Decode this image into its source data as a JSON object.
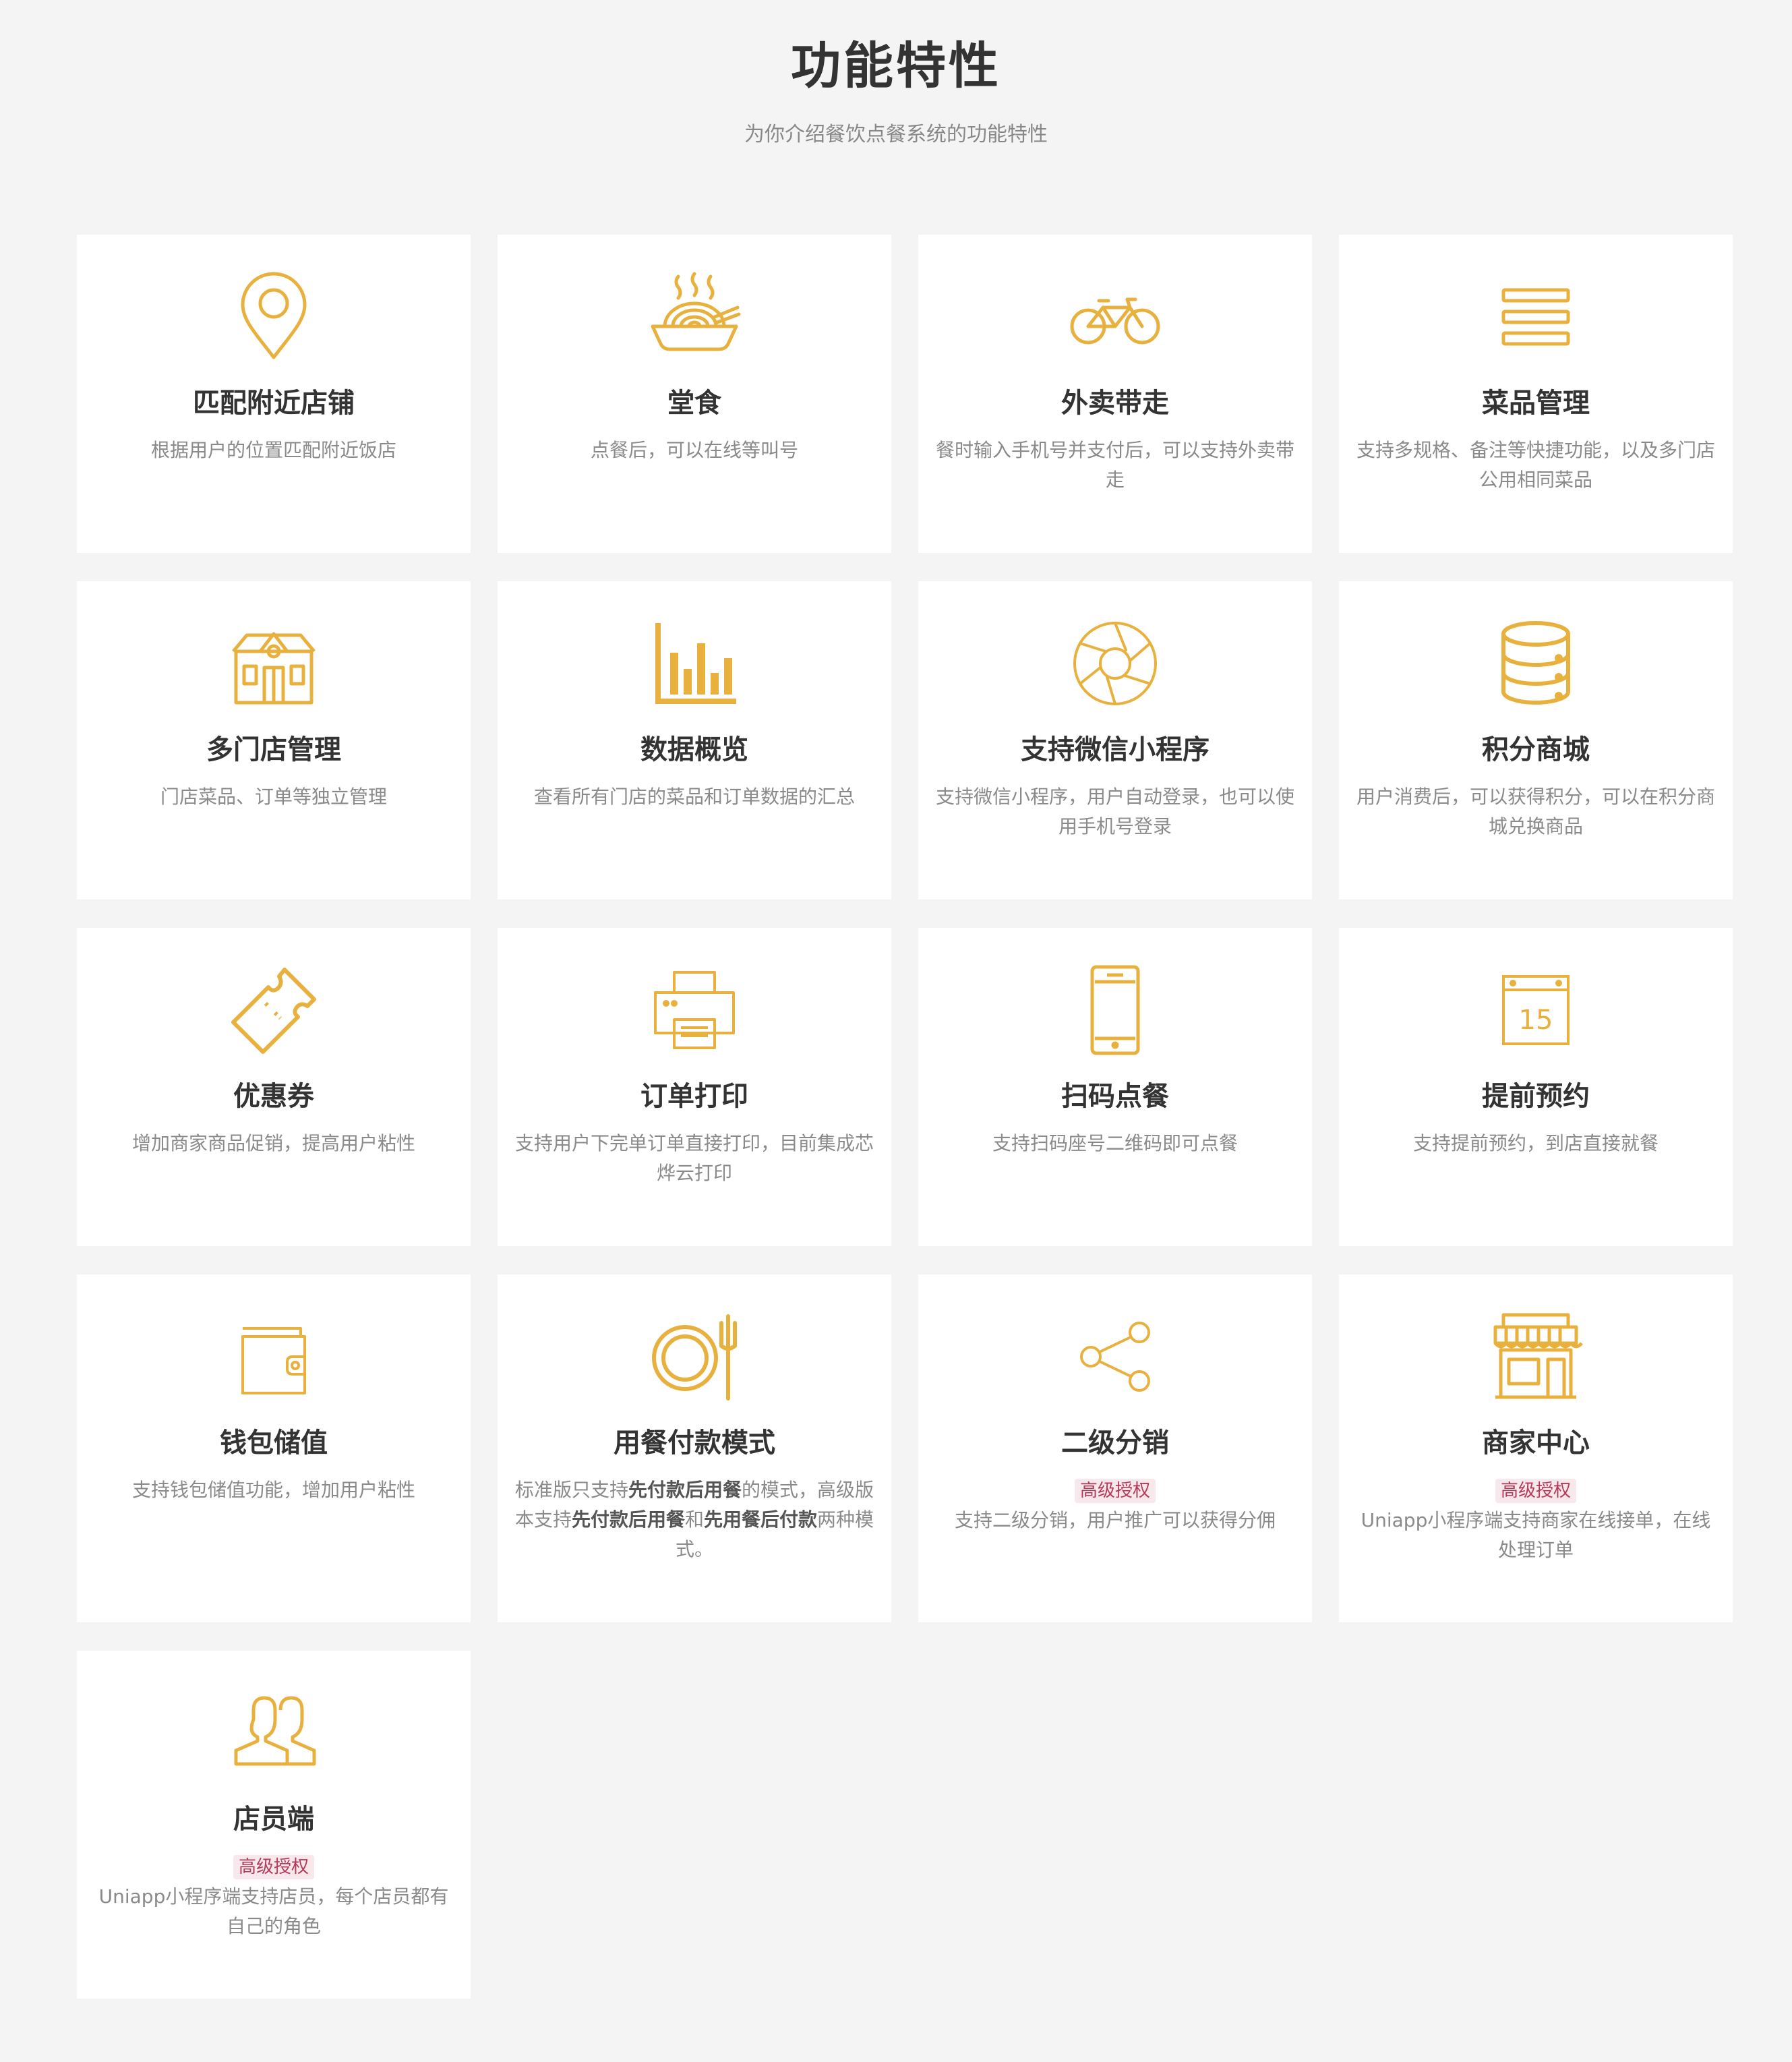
{
  "header": {
    "title": "功能特性",
    "subtitle": "为你介绍餐饮点餐系统的功能特性"
  },
  "colors": {
    "accent": "#e8b13e",
    "badge_bg": "#f8e8ec",
    "badge_text": "#b43a5a"
  },
  "features": [
    {
      "title": "匹配附近店铺",
      "desc": "根据用户的位置匹配附近饭店",
      "icon": "location-pin-icon"
    },
    {
      "title": "堂食",
      "desc": "点餐后，可以在线等叫号",
      "icon": "noodle-bowl-icon"
    },
    {
      "title": "外卖带走",
      "desc": "餐时输入手机号并支付后，可以支持外卖带走",
      "icon": "bicycle-icon"
    },
    {
      "title": "菜品管理",
      "desc": "支持多规格、备注等快捷功能，以及多门店公用相同菜品",
      "icon": "list-bars-icon"
    },
    {
      "title": "多门店管理",
      "desc": "门店菜品、订单等独立管理",
      "icon": "house-icon"
    },
    {
      "title": "数据概览",
      "desc": "查看所有门店的菜品和订单数据的汇总",
      "icon": "bar-chart-icon"
    },
    {
      "title": "支持微信小程序",
      "desc": "支持微信小程序，用户自动登录，也可以使用手机号登录",
      "icon": "aperture-icon"
    },
    {
      "title": "积分商城",
      "desc": "用户消费后，可以获得积分，可以在积分商城兑换商品",
      "icon": "database-icon"
    },
    {
      "title": "优惠券",
      "desc": "增加商家商品促销，提高用户粘性",
      "icon": "ticket-icon"
    },
    {
      "title": "订单打印",
      "desc": "支持用户下完单订单直接打印，目前集成芯烨云打印",
      "icon": "printer-icon"
    },
    {
      "title": "扫码点餐",
      "desc": "支持扫码座号二维码即可点餐",
      "icon": "phone-icon"
    },
    {
      "title": "提前预约",
      "desc": "支持提前预约，到店直接就餐",
      "icon": "calendar-icon",
      "calendar_day": "15"
    },
    {
      "title": "钱包储值",
      "desc": "支持钱包储值功能，增加用户粘性",
      "icon": "wallet-icon"
    },
    {
      "title": "用餐付款模式",
      "desc_parts": [
        "标准版只支持",
        "先付款后用餐",
        "的模式，高级版本支持",
        "先付款后用餐",
        "和",
        "先用餐后付款",
        "两种模式。"
      ],
      "icon": "plate-fork-icon"
    },
    {
      "title": "二级分销",
      "badge": "高级授权",
      "desc": "支持二级分销，用户推广可以获得分佣",
      "icon": "share-icon"
    },
    {
      "title": "商家中心",
      "badge": "高级授权",
      "desc": "Uniapp小程序端支持商家在线接单，在线处理订单",
      "icon": "storefront-icon"
    },
    {
      "title": "店员端",
      "badge": "高级授权",
      "desc": "Uniapp小程序端支持店员，每个店员都有自己的角色",
      "icon": "users-icon"
    }
  ]
}
